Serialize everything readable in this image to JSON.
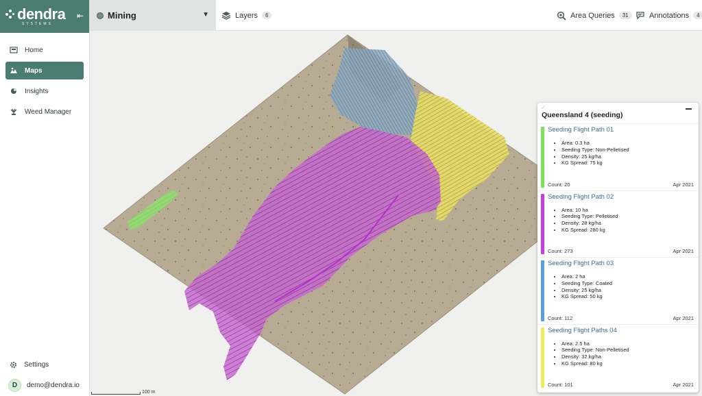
{
  "brand": {
    "name": "dendra",
    "sub": "SYSTEMS"
  },
  "nav": [
    {
      "label": "Home",
      "icon": "home-icon"
    },
    {
      "label": "Maps",
      "icon": "map-icon",
      "active": true
    },
    {
      "label": "Insights",
      "icon": "pie-chart-icon"
    },
    {
      "label": "Weed Manager",
      "icon": "weed-icon"
    }
  ],
  "bottom": {
    "settings": "Settings",
    "user_email": "demo@dendra.io",
    "avatar_initial": "D"
  },
  "topbar": {
    "project": "Mining",
    "layers_label": "Layers",
    "layers_count": "6",
    "area_queries_label": "Area Queries",
    "area_queries_count": "31",
    "annotations_label": "Annotations",
    "annotations_count": "4"
  },
  "map": {
    "scale_label": "100 m"
  },
  "panel": {
    "title": "Queensland 4 (seeding)",
    "cards": [
      {
        "title": "Seeding Flight Path 01",
        "color": "#7be05a",
        "bullets": [
          "Area: 0.3 ha",
          "Seeding Type: Non-Pelletised",
          "Density: 25 kg/ha",
          "KG Spread: 75 kg"
        ],
        "count": "Count: 20",
        "date": "Apr 2021"
      },
      {
        "title": "Seeding Flight Path 02",
        "color": "#c43ee0",
        "bullets": [
          "Area: 10 ha",
          "Seeding Type: Pelletised",
          "Density: 28 kg/ha",
          "KG Spread: 280 kg"
        ],
        "count": "Count: 273",
        "date": "Apr 2021"
      },
      {
        "title": "Seeding Flight Path 03",
        "color": "#5aa0d8",
        "bullets": [
          "Area: 2 ha",
          "Seeding Type: Coated",
          "Density: 25 kg/ha",
          "KG Spread: 50 kg"
        ],
        "count": "Count: 112",
        "date": "Apr 2021"
      },
      {
        "title": "Seeding Flight Paths 04",
        "color": "#f0e95a",
        "bullets": [
          "Area: 2.5 ha",
          "Seeding Type: Non-Pelletised",
          "Density: 32 kg/ha",
          "KG Spread: 80 kg"
        ],
        "count": "Count: 101",
        "date": "Apr 2021"
      }
    ]
  }
}
